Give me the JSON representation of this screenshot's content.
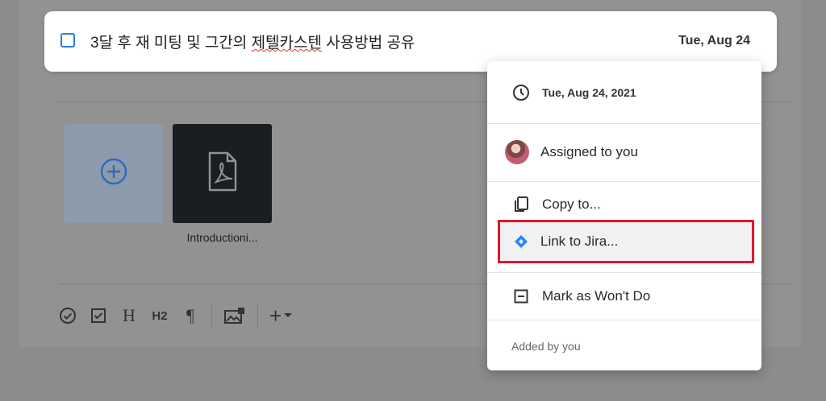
{
  "task": {
    "title_prefix": "3달 후 재 미팅 및 그간의 ",
    "title_spell": "제텔카스텐",
    "title_suffix": " 사용방법 공유",
    "due_short": "Tue, Aug 24"
  },
  "attachments": {
    "file_name": "Introductioni..."
  },
  "menu": {
    "due_full": "Tue, Aug 24, 2021",
    "assigned_label": "Assigned to you",
    "copy_label": "Copy to...",
    "jira_label": "Link to Jira...",
    "wontdo_label": "Mark as Won't Do",
    "added_by": "Added by you"
  },
  "toolbar": {
    "heading_label": "H",
    "h2_label": "H2",
    "paragraph_label": "¶",
    "add_label": "+"
  },
  "colors": {
    "accent": "#2b7de9",
    "highlight": "#e0182d",
    "jira": "#2684ff"
  },
  "icons": [
    "clock-icon",
    "avatar",
    "copy-icon",
    "jira-icon",
    "wont-do-icon",
    "plus-circle-icon",
    "pdf-icon",
    "check-circle-icon",
    "checkbox-icon",
    "image-icon",
    "chevron-down-icon"
  ]
}
